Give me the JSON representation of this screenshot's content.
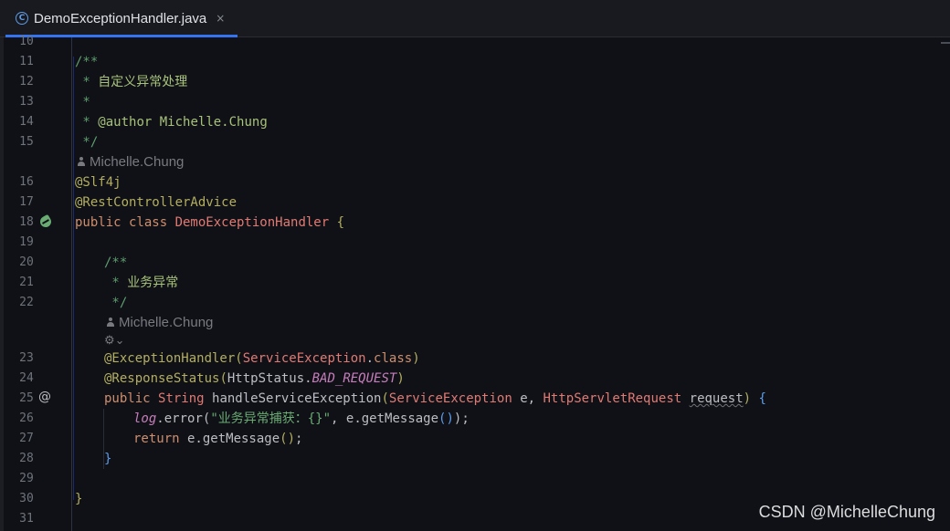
{
  "tab": {
    "title": "DemoExceptionHandler.java",
    "close": "×",
    "icon": "C"
  },
  "watermark": "CSDN @MichelleChung",
  "line_numbers": [
    "10",
    "11",
    "12",
    "13",
    "14",
    "15",
    "16",
    "17",
    "18",
    "19",
    "20",
    "21",
    "22",
    "23",
    "24",
    "25",
    "26",
    "27",
    "28",
    "29",
    "30",
    "31"
  ],
  "hints": {
    "author1": "Michelle.Chung",
    "author2": "Michelle.Chung",
    "ai_glyph": "⚙⌄"
  },
  "code": {
    "l11": "/**",
    "l12_star": " * ",
    "l12_text": "自定义异常处理",
    "l13": " *",
    "l14_star": " * ",
    "l14_tag": "@author",
    "l14_text": " Michelle.Chung",
    "l15": " */",
    "l16": "@Slf4j",
    "l17": "@RestControllerAdvice",
    "l18_kw": "public class ",
    "l18_cls": "DemoExceptionHandler",
    "l18_br": " {",
    "l20": "/**",
    "l21_star": " * ",
    "l21_text": "业务异常",
    "l22": " */",
    "l23_ann": "@ExceptionHandler",
    "l23_p1": "(",
    "l23_cls": "ServiceException",
    "l23_dot": ".",
    "l23_kw": "class",
    "l23_p2": ")",
    "l24_ann": "@ResponseStatus",
    "l24_p1": "(",
    "l24_cls": "HttpStatus",
    "l24_dot": ".",
    "l24_field": "BAD_REQUEST",
    "l24_p2": ")",
    "l25_kw1": "public ",
    "l25_cls1": "String",
    "l25_meth": " handleServiceException",
    "l25_p1": "(",
    "l25_cls2": "ServiceException",
    "l25_e": " e, ",
    "l25_cls3": "HttpServletRequest",
    "l25_sp": " ",
    "l25_req": "request",
    "l25_p2": ")",
    "l25_br": " {",
    "l26_log": "log",
    "l26_err": ".error(",
    "l26_str": "\"业务异常捕获：{}\"",
    "l26_rest": ", e.getMessage",
    "l26_pp": "()",
    "l26_end": ");",
    "l27_kw": "return",
    "l27_rest": " e.getMessage",
    "l27_pp": "()",
    "l27_end": ";",
    "l28": "}",
    "l30": "}"
  }
}
